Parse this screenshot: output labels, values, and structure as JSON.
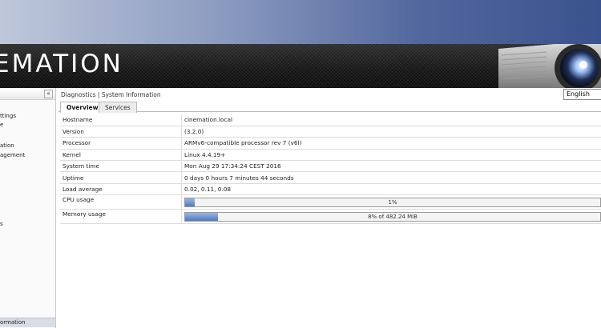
{
  "brand": {
    "logo_text": "EMATION"
  },
  "sidebar": {
    "collapse_label": "«",
    "items": [
      {
        "label": "ttings"
      },
      {
        "label": "e"
      },
      {
        "label": "ation"
      },
      {
        "label": "agement"
      },
      {
        "label": "s"
      }
    ],
    "active_item": "ormation"
  },
  "header": {
    "breadcrumb": "Diagnostics | System Information"
  },
  "language": {
    "selected": "English"
  },
  "tabs": [
    {
      "label": "Overview",
      "active": true
    },
    {
      "label": "Services",
      "active": false
    }
  ],
  "info": [
    {
      "key": "Hostname",
      "value": "cinemation.local"
    },
    {
      "key": "Version",
      "value": "(3.2.0)"
    },
    {
      "key": "Processor",
      "value": "ARMv6-compatible processor rev 7 (v6l)"
    },
    {
      "key": "Kernel",
      "value": "Linux 4.4.19+"
    },
    {
      "key": "System time",
      "value": "Mon Aug 29 17:34:24 CEST 2016"
    },
    {
      "key": "Uptime",
      "value": "0 days 0 hours 7 minutes 44 seconds"
    },
    {
      "key": "Load average",
      "value": "0.02, 0.11, 0.08"
    }
  ],
  "cpu": {
    "label": "CPU usage",
    "percent": 1,
    "text": "1%"
  },
  "memory": {
    "label": "Memory usage",
    "percent": 8,
    "text": "8% of 482.24 MiB"
  },
  "colors": {
    "accent": "#4f78c4",
    "banner": "#151515",
    "sky": "#52679d"
  }
}
